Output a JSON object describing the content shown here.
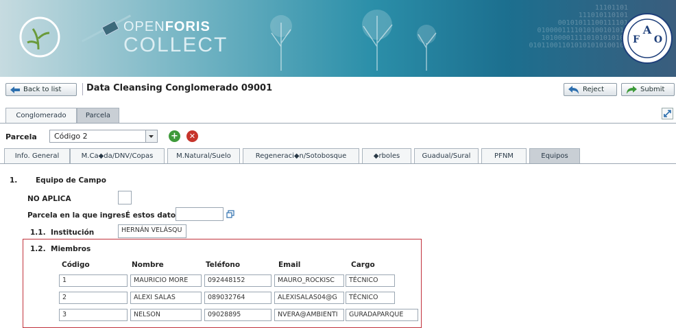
{
  "header": {
    "brand_line1_pre": "OPEN",
    "brand_line1_bold": "FORIS",
    "brand_line2": "COLLECT",
    "binary_text": "11101101\n111010110101\n00101011100111101\n0100001111010100101010\n101000011110101010100\n010110011010101010100101",
    "left_logo_icon": "sprout-circle-icon",
    "right_logo_icon": "fao-seal-icon"
  },
  "toolbar": {
    "back_label": "Back to list",
    "title": "Data Cleansing  Conglomerado  09001",
    "reject_label": "Reject",
    "submit_label": "Submit"
  },
  "top_tabs": [
    {
      "label": "Conglomerado",
      "active": false
    },
    {
      "label": "Parcela",
      "active": true
    }
  ],
  "parcela": {
    "label": "Parcela",
    "selected": "Código 2"
  },
  "sub_tabs": [
    {
      "label": "Info. General",
      "active": false
    },
    {
      "label": "M.Ca◆da/DNV/Copas",
      "active": false
    },
    {
      "label": "M.Natural/Suelo",
      "active": false
    },
    {
      "label": "Regeneraci◆n/Sotobosque",
      "active": false
    },
    {
      "label": "◆rboles",
      "active": false
    },
    {
      "label": "Guadual/Sural",
      "active": false
    },
    {
      "label": "PFNM",
      "active": false
    },
    {
      "label": "Equipos",
      "active": true
    }
  ],
  "form": {
    "section_num": "1.",
    "section_title": "Equipo de Campo",
    "no_aplica_label": "NO APLICA",
    "parcela_ingreso_label": "Parcela en la que ingresÉ estos datos",
    "parcela_ingreso_value": "",
    "institucion_num": "1.1.",
    "institucion_label": "Institución",
    "institucion_value": "HERNÁN VELÁSQU",
    "miembros_num": "1.2.",
    "miembros_label": "Miembros",
    "columns": [
      "Código",
      "Nombre",
      "Teléfono",
      "Email",
      "Cargo"
    ],
    "rows": [
      [
        "1",
        "MAURICIO MORE",
        "092448152",
        "MAURO_ROCKISC",
        "TÉCNICO"
      ],
      [
        "2",
        "ALEXI SALAS",
        "089032764",
        "ALEXISALAS04@G",
        "TÉCNICO"
      ],
      [
        "3",
        "NELSON",
        "09028895",
        "NVERA@AMBIENTI",
        "GURADAPARQUE"
      ]
    ]
  },
  "colors": {
    "accent_red": "#c0303a",
    "add_green": "#3e9a3a",
    "delete_red": "#c6342b",
    "banner_teal": "#2b8fa9"
  }
}
